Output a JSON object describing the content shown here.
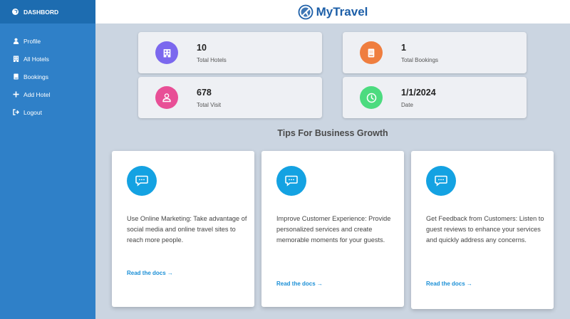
{
  "sidebar": {
    "title": "DASHBORD",
    "items": [
      {
        "label": "Profile",
        "icon": "user-icon"
      },
      {
        "label": "All Hotels",
        "icon": "building-icon"
      },
      {
        "label": "Bookings",
        "icon": "book-icon"
      },
      {
        "label": "Add Hotel",
        "icon": "plus-icon"
      },
      {
        "label": "Logout",
        "icon": "logout-icon"
      }
    ]
  },
  "header": {
    "brand": "MyTravel",
    "icon": "globe-plane-logo"
  },
  "stats": [
    {
      "value": "10",
      "label": "Total Hotels",
      "color": "#7b68ee",
      "icon": "hotel-icon"
    },
    {
      "value": "1",
      "label": "Total Bookings",
      "color": "#ef7e3f",
      "icon": "book-icon"
    },
    {
      "value": "678",
      "label": "Total Visit",
      "color": "#e84f96",
      "icon": "users-icon"
    },
    {
      "value": "1/1/2024",
      "label": "Date",
      "color": "#4cdb7f",
      "icon": "clock-icon"
    }
  ],
  "tips_title": "Tips For Business Growth",
  "tips": [
    {
      "text": "Use Online Marketing: Take advantage of social media and online travel sites to reach more people.",
      "link": "Read the docs →"
    },
    {
      "text": "Improve Customer Experience: Provide personalized services and create memorable moments for your guests.",
      "link": "Read the docs →"
    },
    {
      "text": "Get Feedback from Customers: Listen to guest reviews to enhance your services and quickly address any concerns.",
      "link": "Read the docs →"
    }
  ],
  "colors": {
    "sidebar": "#2f80c8",
    "sidebar_head": "#1d6cb0",
    "brand": "#1d5fa8",
    "accent": "#14a2e2",
    "background": "#cbd5e1"
  }
}
